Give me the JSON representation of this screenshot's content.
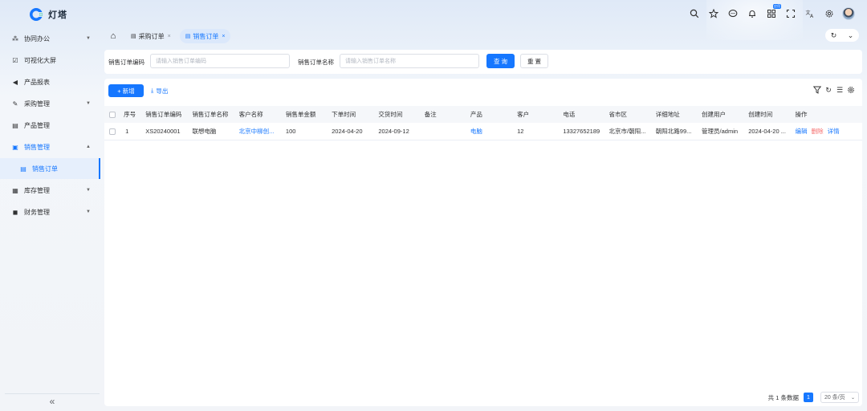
{
  "app": {
    "name": "灯塔"
  },
  "topbar": {
    "icons": [
      "search-icon",
      "star-icon",
      "message-icon",
      "bell-icon",
      "apps-icon",
      "fullscreen-icon",
      "translate-icon",
      "gear-icon",
      "avatar"
    ],
    "apps_badge": "应用"
  },
  "sidebar": {
    "items": [
      {
        "label": "协同办公",
        "icon": "collab-icon",
        "arrow": "chevron-down"
      },
      {
        "label": "可视化大屏",
        "icon": "screen-icon"
      },
      {
        "label": "产品报表",
        "icon": "report-icon"
      },
      {
        "label": "采购管理",
        "icon": "pen-icon",
        "arrow": "chevron-down"
      },
      {
        "label": "产品管理",
        "icon": "product-icon"
      },
      {
        "label": "销售管理",
        "icon": "sales-icon",
        "arrow": "chevron-up"
      },
      {
        "label": "销售订单",
        "icon": "doc-icon"
      },
      {
        "label": "库存管理",
        "icon": "stock-icon",
        "arrow": "chevron-down"
      },
      {
        "label": "财务管理",
        "icon": "finance-icon",
        "arrow": "chevron-down"
      }
    ],
    "collapse": "«"
  },
  "tabs": {
    "items": [
      {
        "label": "采购订单",
        "close": "×"
      },
      {
        "label": "销售订单",
        "close": "×"
      }
    ],
    "active": "销售订单"
  },
  "search": {
    "code_label": "销售订单编码",
    "code_placeholder": "请输入销售订单编码",
    "name_label": "销售订单名称",
    "name_placeholder": "请输入销售订单名称",
    "query_button": "查 询",
    "reset_button": "重 置"
  },
  "toolbar": {
    "add_button": "+ 新增",
    "export_button": "导出"
  },
  "table": {
    "columns": [
      "序号",
      "销售订单编码",
      "销售订单名称",
      "客户名称",
      "销售单金额",
      "下单时间",
      "交货时间",
      "备注",
      "产品",
      "客户",
      "电话",
      "省市区",
      "详细地址",
      "创建用户",
      "创建时间",
      "操作"
    ],
    "rows": [
      {
        "index": "1",
        "code": "XS20240001",
        "name": "联想电脑",
        "customer": "北京中柳创...",
        "amount": "100",
        "order_date": "2024-04-20",
        "delivery_date": "2024-09-12",
        "note": "",
        "product": "电脑",
        "client": "12",
        "phone": "13327652189",
        "region": "北京市/朝阳...",
        "address": "朝阳北路99...",
        "creator": "管理员/admin",
        "created_at": "2024-04-20 ...",
        "actions": {
          "edit": "编辑",
          "delete": "删除",
          "detail": "详情"
        }
      }
    ]
  },
  "pagination": {
    "total": "共 1 条数据",
    "current_page": "1",
    "page_size": "20 条/页"
  },
  "colors": {
    "primary": "#1677ff",
    "danger": "#f56c6c"
  }
}
